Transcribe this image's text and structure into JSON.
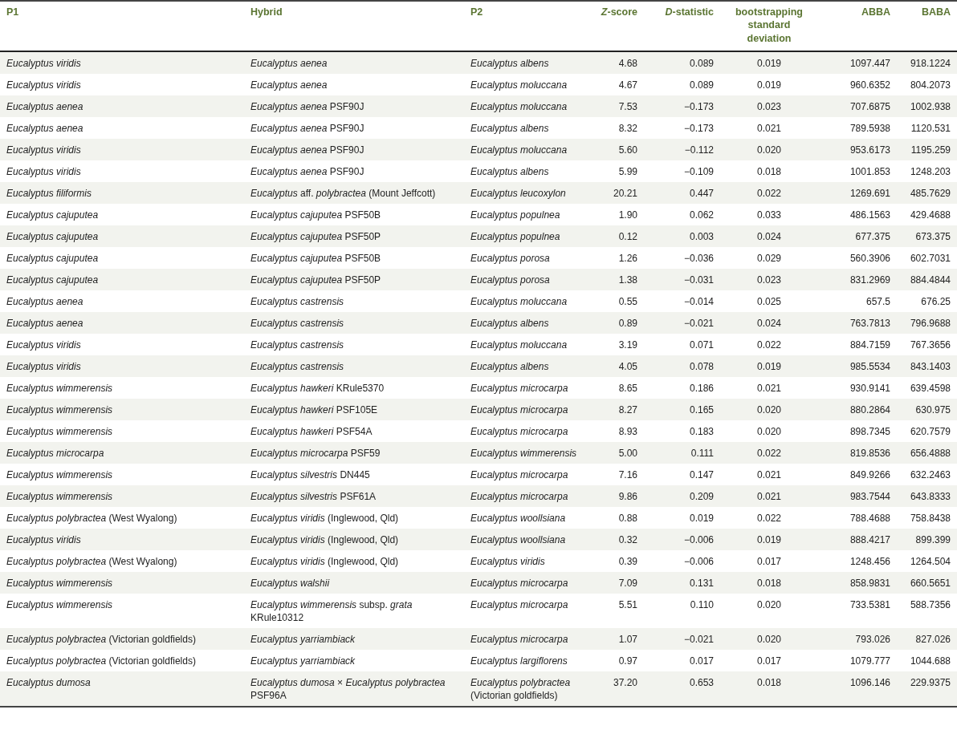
{
  "table": {
    "columns": [
      "P1",
      "Hybrid",
      "P2",
      "*Z*-score",
      "*D*-statistic",
      "bootstrapping standard deviation",
      "ABBA",
      "BABA"
    ],
    "rows": [
      {
        "p1": {
          "text": "Eucalyptus viridis",
          "italic": true
        },
        "hybrid": {
          "text": "Eucalyptus aenea",
          "italic": true
        },
        "p2": {
          "text": "Eucalyptus albens",
          "italic": true
        },
        "values": [
          "4.68",
          "0.089",
          "0.019",
          "1097.447",
          "918.1224"
        ]
      },
      {
        "p1": {
          "text": "Eucalyptus viridis",
          "italic": true
        },
        "hybrid": {
          "text": "Eucalyptus aenea",
          "italic": true
        },
        "p2": {
          "text": "Eucalyptus moluccana",
          "italic": true
        },
        "values": [
          "4.67",
          "0.089",
          "0.019",
          "960.6352",
          "804.2073"
        ]
      },
      {
        "p1": {
          "text": "Eucalyptus aenea",
          "italic": true
        },
        "hybrid": {
          "text": "*Eucalyptus aenea* PSF90J",
          "italic": false
        },
        "p2": {
          "text": "Eucalyptus moluccana",
          "italic": true
        },
        "values": [
          "7.53",
          "−0.173",
          "0.023",
          "707.6875",
          "1002.938"
        ]
      },
      {
        "p1": {
          "text": "Eucalyptus aenea",
          "italic": true
        },
        "hybrid": {
          "text": "*Eucalyptus aenea* PSF90J",
          "italic": false
        },
        "p2": {
          "text": "Eucalyptus albens",
          "italic": true
        },
        "values": [
          "8.32",
          "−0.173",
          "0.021",
          "789.5938",
          "1120.531"
        ]
      },
      {
        "p1": {
          "text": "Eucalyptus viridis",
          "italic": true
        },
        "hybrid": {
          "text": "*Eucalyptus aenea* PSF90J",
          "italic": false
        },
        "p2": {
          "text": "Eucalyptus moluccana",
          "italic": true
        },
        "values": [
          "5.60",
          "−0.112",
          "0.020",
          "953.6173",
          "1195.259"
        ]
      },
      {
        "p1": {
          "text": "Eucalyptus viridis",
          "italic": true
        },
        "hybrid": {
          "text": "*Eucalyptus aenea* PSF90J",
          "italic": false
        },
        "p2": {
          "text": "Eucalyptus albens",
          "italic": true
        },
        "values": [
          "5.99",
          "−0.109",
          "0.018",
          "1001.853",
          "1248.203"
        ]
      },
      {
        "p1": {
          "text": "Eucalyptus filiformis",
          "italic": true
        },
        "hybrid": {
          "text": "*Eucalyptus* aff. *polybractea* (Mount Jeffcott)",
          "italic": false
        },
        "p2": {
          "text": "Eucalyptus leucoxylon",
          "italic": true
        },
        "values": [
          "20.21",
          "0.447",
          "0.022",
          "1269.691",
          "485.7629"
        ]
      },
      {
        "p1": {
          "text": "Eucalyptus cajuputea",
          "italic": true
        },
        "hybrid": {
          "text": "*Eucalyptus cajuputea* PSF50B",
          "italic": false
        },
        "p2": {
          "text": "Eucalyptus populnea",
          "italic": true
        },
        "values": [
          "1.90",
          "0.062",
          "0.033",
          "486.1563",
          "429.4688"
        ]
      },
      {
        "p1": {
          "text": "Eucalyptus cajuputea",
          "italic": true
        },
        "hybrid": {
          "text": "*Eucalyptus cajuputea* PSF50P",
          "italic": false
        },
        "p2": {
          "text": "Eucalyptus populnea",
          "italic": true
        },
        "values": [
          "0.12",
          "0.003",
          "0.024",
          "677.375",
          "673.375"
        ]
      },
      {
        "p1": {
          "text": "Eucalyptus cajuputea",
          "italic": true
        },
        "hybrid": {
          "text": "*Eucalyptus cajuputea* PSF50B",
          "italic": false
        },
        "p2": {
          "text": "Eucalyptus porosa",
          "italic": true
        },
        "values": [
          "1.26",
          "−0.036",
          "0.029",
          "560.3906",
          "602.7031"
        ]
      },
      {
        "p1": {
          "text": "Eucalyptus cajuputea",
          "italic": true
        },
        "hybrid": {
          "text": "*Eucalyptus cajuputea* PSF50P",
          "italic": false
        },
        "p2": {
          "text": "Eucalyptus porosa",
          "italic": true
        },
        "values": [
          "1.38",
          "−0.031",
          "0.023",
          "831.2969",
          "884.4844"
        ]
      },
      {
        "p1": {
          "text": "Eucalyptus aenea",
          "italic": true
        },
        "hybrid": {
          "text": "Eucalyptus castrensis",
          "italic": true
        },
        "p2": {
          "text": "Eucalyptus moluccana",
          "italic": true
        },
        "values": [
          "0.55",
          "−0.014",
          "0.025",
          "657.5",
          "676.25"
        ]
      },
      {
        "p1": {
          "text": "Eucalyptus aenea",
          "italic": true
        },
        "hybrid": {
          "text": "Eucalyptus castrensis",
          "italic": true
        },
        "p2": {
          "text": "Eucalyptus albens",
          "italic": true
        },
        "values": [
          "0.89",
          "−0.021",
          "0.024",
          "763.7813",
          "796.9688"
        ]
      },
      {
        "p1": {
          "text": "Eucalyptus viridis",
          "italic": true
        },
        "hybrid": {
          "text": "Eucalyptus castrensis",
          "italic": true
        },
        "p2": {
          "text": "Eucalyptus moluccana",
          "italic": true
        },
        "values": [
          "3.19",
          "0.071",
          "0.022",
          "884.7159",
          "767.3656"
        ]
      },
      {
        "p1": {
          "text": "Eucalyptus viridis",
          "italic": true
        },
        "hybrid": {
          "text": "Eucalyptus castrensis",
          "italic": true
        },
        "p2": {
          "text": "Eucalyptus albens",
          "italic": true
        },
        "values": [
          "4.05",
          "0.078",
          "0.019",
          "985.5534",
          "843.1403"
        ]
      },
      {
        "p1": {
          "text": "Eucalyptus wimmerensis",
          "italic": true
        },
        "hybrid": {
          "text": "*Eucalyptus hawkeri* KRule5370",
          "italic": false
        },
        "p2": {
          "text": "Eucalyptus microcarpa",
          "italic": true
        },
        "values": [
          "8.65",
          "0.186",
          "0.021",
          "930.9141",
          "639.4598"
        ]
      },
      {
        "p1": {
          "text": "Eucalyptus wimmerensis",
          "italic": true
        },
        "hybrid": {
          "text": "*Eucalyptus hawkeri* PSF105E",
          "italic": false
        },
        "p2": {
          "text": "Eucalyptus microcarpa",
          "italic": true
        },
        "values": [
          "8.27",
          "0.165",
          "0.020",
          "880.2864",
          "630.975"
        ]
      },
      {
        "p1": {
          "text": "Eucalyptus wimmerensis",
          "italic": true
        },
        "hybrid": {
          "text": "*Eucalyptus hawkeri* PSF54A",
          "italic": false
        },
        "p2": {
          "text": "Eucalyptus microcarpa",
          "italic": true
        },
        "values": [
          "8.93",
          "0.183",
          "0.020",
          "898.7345",
          "620.7579"
        ]
      },
      {
        "p1": {
          "text": "Eucalyptus microcarpa",
          "italic": true
        },
        "hybrid": {
          "text": "*Eucalyptus microcarpa* PSF59",
          "italic": false
        },
        "p2": {
          "text": "Eucalyptus wimmerensis",
          "italic": true
        },
        "values": [
          "5.00",
          "0.111",
          "0.022",
          "819.8536",
          "656.4888"
        ]
      },
      {
        "p1": {
          "text": "Eucalyptus wimmerensis",
          "italic": true
        },
        "hybrid": {
          "text": "*Eucalyptus silvestris* DN445",
          "italic": false
        },
        "p2": {
          "text": "Eucalyptus microcarpa",
          "italic": true
        },
        "values": [
          "7.16",
          "0.147",
          "0.021",
          "849.9266",
          "632.2463"
        ]
      },
      {
        "p1": {
          "text": "Eucalyptus wimmerensis",
          "italic": true
        },
        "hybrid": {
          "text": "*Eucalyptus silvestris* PSF61A",
          "italic": false
        },
        "p2": {
          "text": "Eucalyptus microcarpa",
          "italic": true
        },
        "values": [
          "9.86",
          "0.209",
          "0.021",
          "983.7544",
          "643.8333"
        ]
      },
      {
        "p1": {
          "text": "*Eucalyptus polybractea* (West Wyalong)",
          "italic": false
        },
        "hybrid": {
          "text": "*Eucalyptus viridis* (Inglewood, Qld)",
          "italic": false
        },
        "p2": {
          "text": "Eucalyptus woollsiana",
          "italic": true
        },
        "values": [
          "0.88",
          "0.019",
          "0.022",
          "788.4688",
          "758.8438"
        ]
      },
      {
        "p1": {
          "text": "Eucalyptus viridis",
          "italic": true
        },
        "hybrid": {
          "text": "*Eucalyptus viridis* (Inglewood, Qld)",
          "italic": false
        },
        "p2": {
          "text": "Eucalyptus woollsiana",
          "italic": true
        },
        "values": [
          "0.32",
          "−0.006",
          "0.019",
          "888.4217",
          "899.399"
        ]
      },
      {
        "p1": {
          "text": "*Eucalyptus polybractea* (West Wyalong)",
          "italic": false
        },
        "hybrid": {
          "text": "*Eucalyptus viridis* (Inglewood, Qld)",
          "italic": false
        },
        "p2": {
          "text": "Eucalyptus viridis",
          "italic": true
        },
        "values": [
          "0.39",
          "−0.006",
          "0.017",
          "1248.456",
          "1264.504"
        ]
      },
      {
        "p1": {
          "text": "Eucalyptus wimmerensis",
          "italic": true
        },
        "hybrid": {
          "text": "Eucalyptus walshii",
          "italic": true
        },
        "p2": {
          "text": "Eucalyptus microcarpa",
          "italic": true
        },
        "values": [
          "7.09",
          "0.131",
          "0.018",
          "858.9831",
          "660.5651"
        ]
      },
      {
        "p1": {
          "text": "Eucalyptus wimmerensis",
          "italic": true
        },
        "hybrid": {
          "text": "*Eucalyptus wimmerensis* subsp. *grata* KRule10312",
          "italic": false
        },
        "p2": {
          "text": "Eucalyptus microcarpa",
          "italic": true
        },
        "values": [
          "5.51",
          "0.110",
          "0.020",
          "733.5381",
          "588.7356"
        ]
      },
      {
        "p1": {
          "text": "*Eucalyptus polybractea* (Victorian goldfields)",
          "italic": false
        },
        "hybrid": {
          "text": "Eucalyptus yarriambiack",
          "italic": true
        },
        "p2": {
          "text": "Eucalyptus microcarpa",
          "italic": true
        },
        "values": [
          "1.07",
          "−0.021",
          "0.020",
          "793.026",
          "827.026"
        ]
      },
      {
        "p1": {
          "text": "*Eucalyptus polybractea* (Victorian goldfields)",
          "italic": false
        },
        "hybrid": {
          "text": "Eucalyptus yarriambiack",
          "italic": true
        },
        "p2": {
          "text": "Eucalyptus largiflorens",
          "italic": true
        },
        "values": [
          "0.97",
          "0.017",
          "0.017",
          "1079.777",
          "1044.688"
        ]
      },
      {
        "p1": {
          "text": "Eucalyptus dumosa",
          "italic": true
        },
        "hybrid": {
          "text": "*Eucalyptus dumosa* × *Eucalyptus polybractea* PSF96A",
          "italic": false
        },
        "p2": {
          "text": "*Eucalyptus polybractea* (Victorian goldfields)",
          "italic": false
        },
        "values": [
          "37.20",
          "0.653",
          "0.018",
          "1096.146",
          "229.9375"
        ]
      }
    ]
  }
}
